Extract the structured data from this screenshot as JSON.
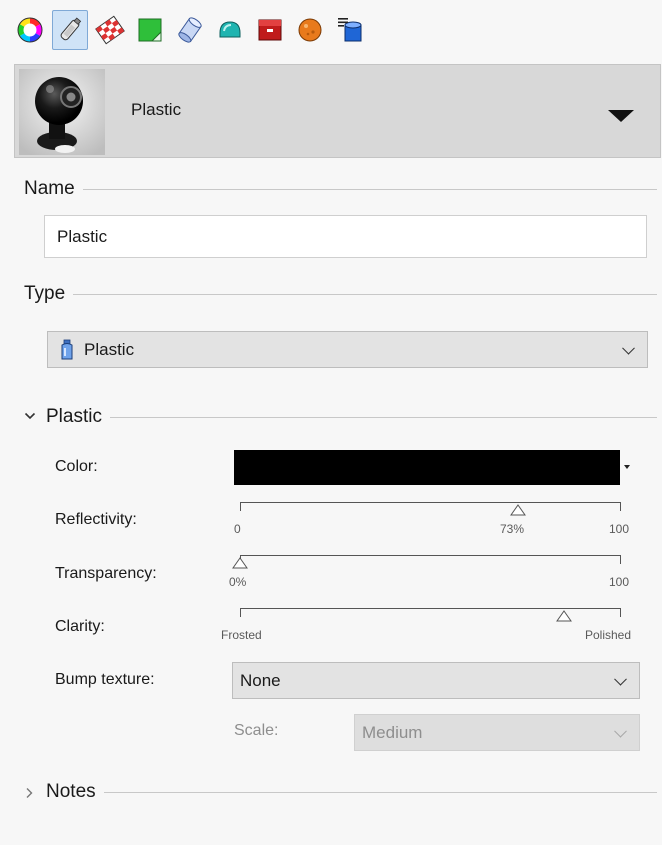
{
  "toolbar": {
    "tools": [
      {
        "icon": "color-wheel-icon",
        "active": false
      },
      {
        "icon": "plastic-bottle-icon",
        "active": true
      },
      {
        "icon": "checker-texture-icon",
        "active": false
      },
      {
        "icon": "green-sheet-icon",
        "active": false
      },
      {
        "icon": "glass-cylinder-icon",
        "active": false
      },
      {
        "icon": "teal-shape-icon",
        "active": false
      },
      {
        "icon": "red-box-icon",
        "active": false
      },
      {
        "icon": "orange-sphere-icon",
        "active": false
      },
      {
        "icon": "blue-cylinder-list-icon",
        "active": false
      }
    ]
  },
  "material": {
    "name": "Plastic",
    "thumbnail_icon": "plastic-material-preview"
  },
  "name_section": {
    "label": "Name",
    "value": "Plastic"
  },
  "type_section": {
    "label": "Type",
    "value": "Plastic",
    "icon": "plastic-bottle-icon"
  },
  "plastic_section": {
    "label": "Plastic",
    "expanded": true,
    "color": {
      "label": "Color:",
      "value": "#000000"
    },
    "reflectivity": {
      "label": "Reflectivity:",
      "min": "0",
      "max": "100",
      "value": 73,
      "value_label": "73%"
    },
    "transparency": {
      "label": "Transparency:",
      "max": "100",
      "value": 0,
      "value_label": "0%"
    },
    "clarity": {
      "label": "Clarity:",
      "min": "Frosted",
      "max": "Polished",
      "value": 85
    },
    "bump": {
      "label": "Bump texture:",
      "value": "None"
    },
    "scale": {
      "label": "Scale:",
      "value": "Medium",
      "disabled": true
    }
  },
  "notes_section": {
    "label": "Notes",
    "expanded": false
  }
}
